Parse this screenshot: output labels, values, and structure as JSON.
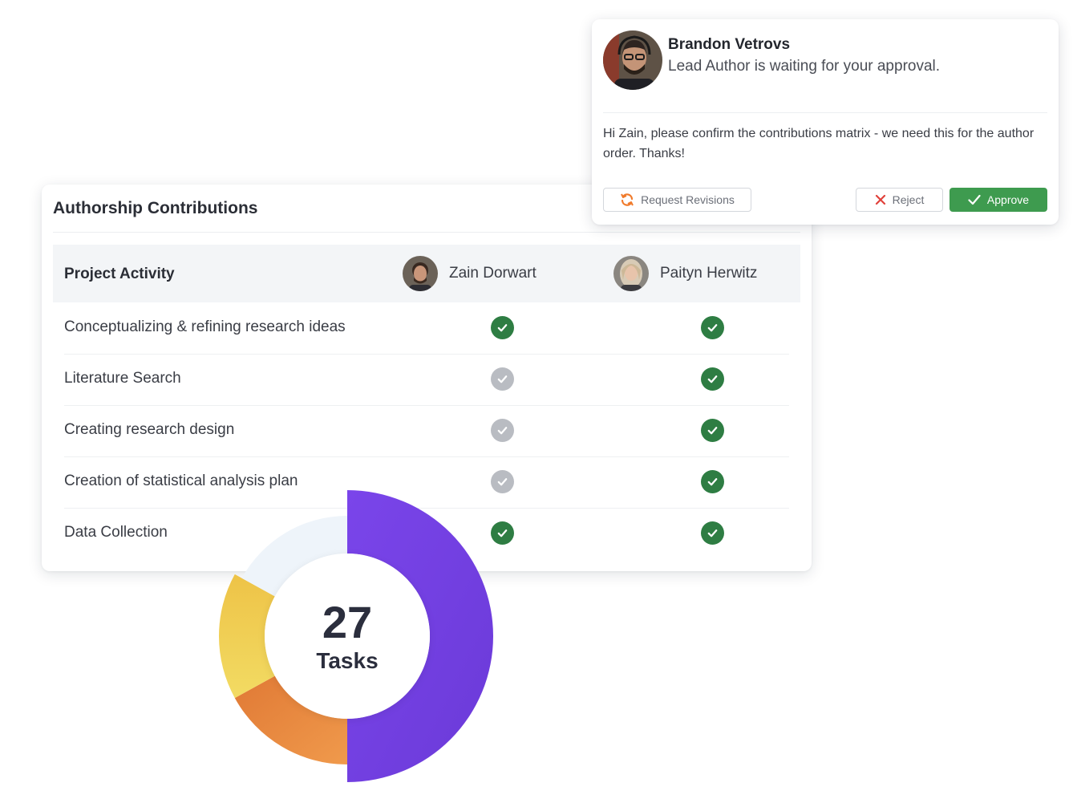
{
  "contributions": {
    "title": "Authorship Contributions",
    "column_header": "Project Activity",
    "people": [
      {
        "name": "Zain Dorwart"
      },
      {
        "name": "Paityn Herwitz"
      }
    ],
    "rows": [
      {
        "activity": "Conceptualizing & refining research ideas",
        "checks": [
          true,
          true
        ]
      },
      {
        "activity": "Literature Search",
        "checks": [
          false,
          true
        ]
      },
      {
        "activity": "Creating research design",
        "checks": [
          false,
          true
        ]
      },
      {
        "activity": "Creation of statistical analysis plan",
        "checks": [
          false,
          true
        ]
      },
      {
        "activity": "Data Collection",
        "checks": [
          true,
          true
        ]
      }
    ],
    "check_colors": {
      "done": "#2e7d43",
      "pending": "#b9bcc2"
    }
  },
  "tasks": {
    "count": "27",
    "label": "Tasks",
    "segments_percent": {
      "purple": 50,
      "orange": 17,
      "yellow": 16,
      "light_blue": 17
    },
    "colors": {
      "purple": "#7b3fe4",
      "orange": "#ec8a3d",
      "yellow": "#f1d04f",
      "light_blue": "#eef4fa"
    }
  },
  "notification": {
    "sender": "Brandon Vetrovs",
    "subtitle": "Lead Author is waiting for your approval.",
    "message": "Hi Zain, please confirm the contributions matrix  - we need this for the author order. Thanks!",
    "actions": {
      "revise": "Request Revisions",
      "reject": "Reject",
      "approve": "Approve"
    },
    "colors": {
      "approve": "#3e9b4f",
      "reject_icon": "#e0413b",
      "revise_icon": "#f07a2b"
    }
  }
}
